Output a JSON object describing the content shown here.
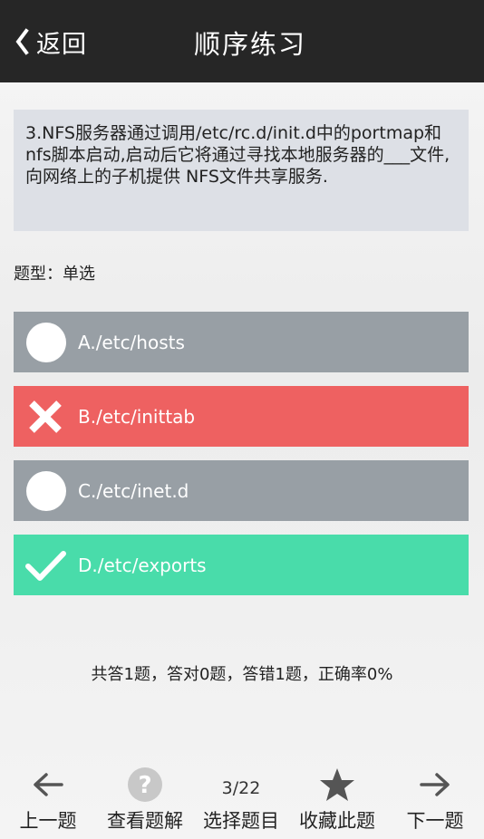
{
  "header": {
    "back_label": "返回",
    "title": "顺序练习"
  },
  "question": {
    "text": "3.NFS服务器通过调用/etc/rc.d/init.d中的portmap和nfs脚本启动,启动后它将通过寻找本地服务器的___文件,向网络上的子机提供 NFS文件共享服务.",
    "type_label": "题型：单选"
  },
  "options": [
    {
      "label": "A./etc/hosts",
      "state": "unselected",
      "icon": "circle-icon",
      "color": "#989fa5"
    },
    {
      "label": "B./etc/inittab",
      "state": "wrong",
      "icon": "cross-icon",
      "color": "#ee6161"
    },
    {
      "label": "C./etc/inet.d",
      "state": "unselected",
      "icon": "circle-icon",
      "color": "#989fa5"
    },
    {
      "label": "D./etc/exports",
      "state": "correct",
      "icon": "check-icon",
      "color": "#49dcaa"
    }
  ],
  "stats": "共答1题，答对0题，答错1题，正确率0%",
  "bottom_nav": {
    "prev": {
      "label": "上一题",
      "icon": "arrow-left-icon"
    },
    "explain": {
      "label": "查看题解",
      "icon": "question-icon"
    },
    "select": {
      "label": "选择题目",
      "counter": "3/22"
    },
    "favorite": {
      "label": "收藏此题",
      "icon": "star-icon"
    },
    "next": {
      "label": "下一题",
      "icon": "arrow-right-icon"
    }
  }
}
